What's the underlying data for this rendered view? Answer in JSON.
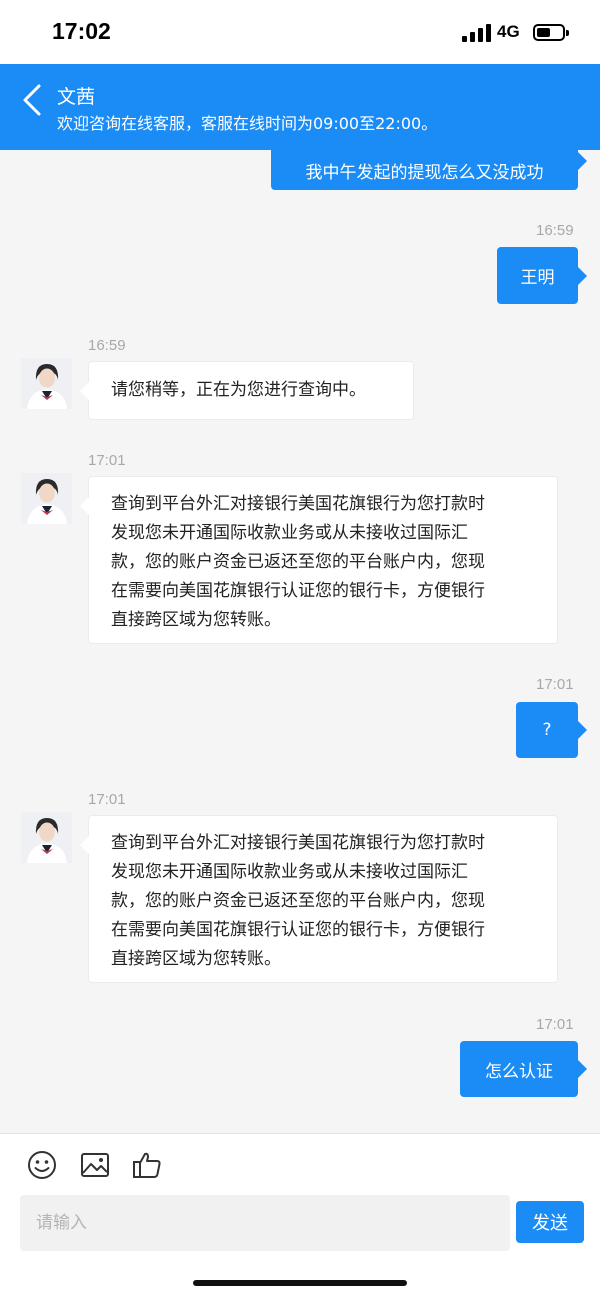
{
  "status_bar": {
    "time": "17:02",
    "network": "4G",
    "battery_level": 0.45
  },
  "header": {
    "title": "文茜",
    "subtitle": "欢迎咨询在线客服，客服在线时间为09:00至22:00。"
  },
  "messages": [
    {
      "dir": "out",
      "text": "我中午发起的提现怎么又没成功"
    },
    {
      "dir": "out",
      "time": "16:59",
      "text": "王明"
    },
    {
      "dir": "in",
      "time": "16:59",
      "lines": [
        "请您稍等，正在为您进行查询中。"
      ]
    },
    {
      "dir": "in",
      "time": "17:01",
      "lines": [
        "查询到平台外汇对接银行美国花旗银行为您打款时",
        "发现您未开通国际收款业务或从未接收过国际汇",
        "款，您的账户资金已返还至您的平台账户内，您现",
        "在需要向美国花旗银行认证您的银行卡，方便银行",
        "直接跨区域为您转账。"
      ]
    },
    {
      "dir": "out",
      "time": "17:01",
      "text": "?"
    },
    {
      "dir": "in",
      "time": "17:01",
      "lines": [
        "查询到平台外汇对接银行美国花旗银行为您打款时",
        "发现您未开通国际收款业务或从未接收过国际汇",
        "款，您的账户资金已返还至您的平台账户内，您现",
        "在需要向美国花旗银行认证您的银行卡，方便银行",
        "直接跨区域为您转账。"
      ]
    },
    {
      "dir": "out",
      "time": "17:01",
      "text": "怎么认证"
    }
  ],
  "toolbar": {
    "icons": [
      "emoji-icon",
      "image-icon",
      "thumbs-up-icon"
    ]
  },
  "composer": {
    "placeholder": "请输入",
    "value": "",
    "send_label": "发送"
  },
  "colors": {
    "accent": "#1b8cf5",
    "background": "#f5f5f5",
    "time_gray": "#a8a8a8"
  }
}
